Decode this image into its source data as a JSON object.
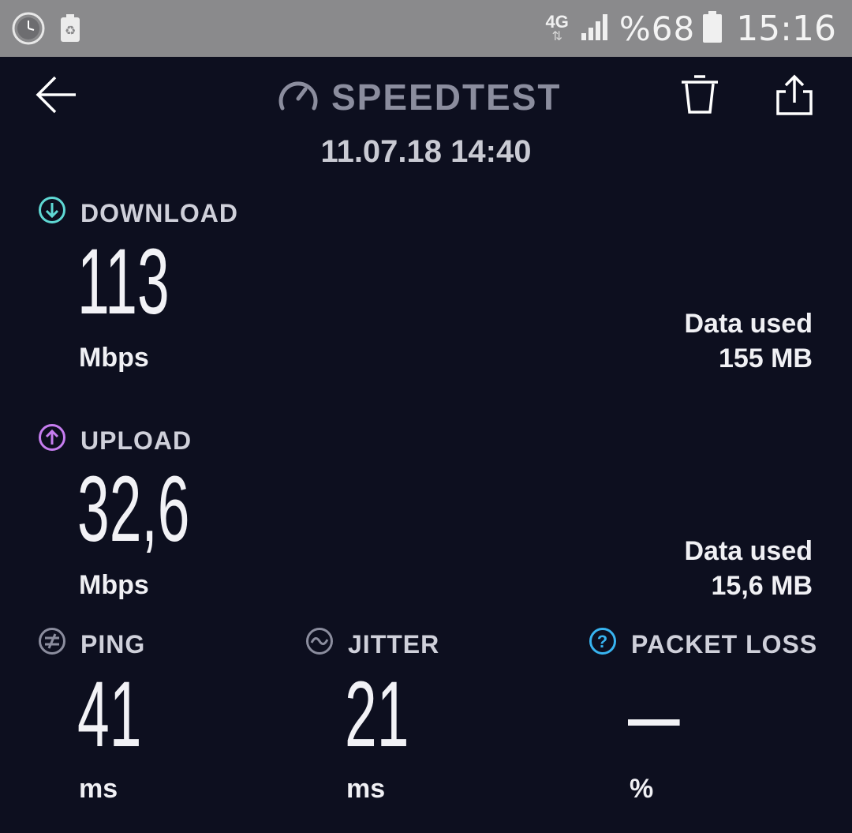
{
  "status_bar": {
    "network_type": "4G",
    "battery": "%68",
    "time": "15:16",
    "icons": [
      "clock-widget-icon",
      "recycle-notification-icon",
      "signal-icon",
      "battery-icon"
    ]
  },
  "header": {
    "title": "SPEEDTEST",
    "datetime": "11.07.18 14:40",
    "icons": [
      "back-arrow-icon",
      "speedometer-icon",
      "trash-icon",
      "share-icon"
    ]
  },
  "download": {
    "label": "DOWNLOAD",
    "value": "113",
    "unit": "Mbps",
    "data_used_label": "Data used",
    "data_used_value": "155 MB",
    "icon_color": "#5fd8d4"
  },
  "upload": {
    "label": "UPLOAD",
    "value": "32,6",
    "unit": "Mbps",
    "data_used_label": "Data used",
    "data_used_value": "15,6 MB",
    "icon_color": "#c67df0"
  },
  "ping": {
    "label": "PING",
    "value": "41",
    "unit": "ms"
  },
  "jitter": {
    "label": "JITTER",
    "value": "21",
    "unit": "ms"
  },
  "packet_loss": {
    "label": "PACKET LOSS",
    "value": "–",
    "unit": "%",
    "icon_color": "#38b4f0"
  },
  "colors": {
    "background": "#0d0f1f",
    "status_bar": "#8a8a8c",
    "title": "#8b8d9e"
  }
}
